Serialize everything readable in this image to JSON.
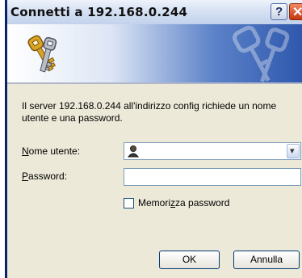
{
  "window": {
    "title": "Connetti a 192.168.0.244",
    "help_glyph": "?",
    "close_glyph": "✕"
  },
  "banner": {
    "keys_icon": "keys-icon"
  },
  "message": "Il server 192.168.0.244 all'indirizzo config richiede un nome utente e una password.",
  "username": {
    "label_first": "N",
    "label_rest": "ome utente:",
    "value": "",
    "user_icon": "user-icon",
    "dropdown_glyph": "▾"
  },
  "password": {
    "label_first": "P",
    "label_rest": "assword:",
    "value": ""
  },
  "remember": {
    "label_pre": "Memori",
    "label_accel": "z",
    "label_post": "za password",
    "checked": false
  },
  "buttons": {
    "ok": "OK",
    "cancel": "Annulla"
  },
  "colors": {
    "title_accent": "#0a246a",
    "banner_dark": "#2f58ad"
  }
}
